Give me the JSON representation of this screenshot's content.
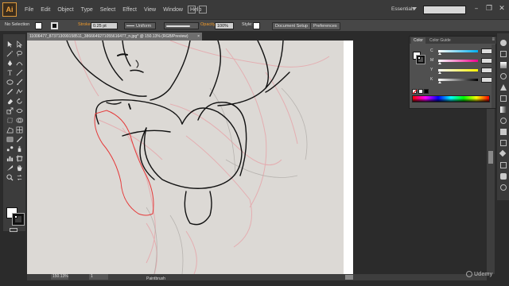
{
  "app": {
    "logo": "Ai",
    "workspace": "Essentials"
  },
  "menu": [
    "File",
    "Edit",
    "Object",
    "Type",
    "Select",
    "Effect",
    "View",
    "Window",
    "Help"
  ],
  "window_buttons": [
    "–",
    "❐",
    "✕"
  ],
  "control_bar": {
    "selection": "No Selection",
    "stroke_label": "Stroke:",
    "stroke_weight": "0.25 pt",
    "profile": "Uniform",
    "opacity_label": "Opacity:",
    "opacity_value": "100%",
    "style_label": "Style:",
    "document_setup": "Document Setup",
    "preferences": "Preferences"
  },
  "document_tab": {
    "title": "11006477_873713099158511_3866649271055616477_n.jpg* @ 150.13% (RGB/Preview)",
    "close": "×"
  },
  "status_bar": {
    "zoom": "150.13%",
    "page": "1",
    "active_tool": "Paintbrush"
  },
  "color_panel": {
    "tabs": [
      "Color",
      "Color Guide"
    ],
    "sliders": [
      {
        "label": "C",
        "gradient": "#00aeef"
      },
      {
        "label": "M",
        "gradient": "#ec008c"
      },
      {
        "label": "Y",
        "gradient": "#fff200"
      },
      {
        "label": "K",
        "gradient": "#000000"
      }
    ]
  },
  "tools": [
    "selection-icon",
    "direct-selection-icon",
    "magic-wand-icon",
    "lasso-icon",
    "pen-icon",
    "curvature-icon",
    "type-icon",
    "line-icon",
    "rectangle-icon",
    "paintbrush-icon",
    "pencil-icon",
    "shaper-icon",
    "eraser-icon",
    "rotate-icon",
    "scale-icon",
    "width-icon",
    "free-transform-icon",
    "shape-builder-icon",
    "perspective-icon",
    "mesh-icon",
    "gradient-icon",
    "eyedropper-icon",
    "blend-icon",
    "symbol-sprayer-icon",
    "column-graph-icon",
    "artboard-icon",
    "slice-icon",
    "hand-icon",
    "zoom-icon",
    "swap-icon"
  ],
  "watermark": "Udemy"
}
